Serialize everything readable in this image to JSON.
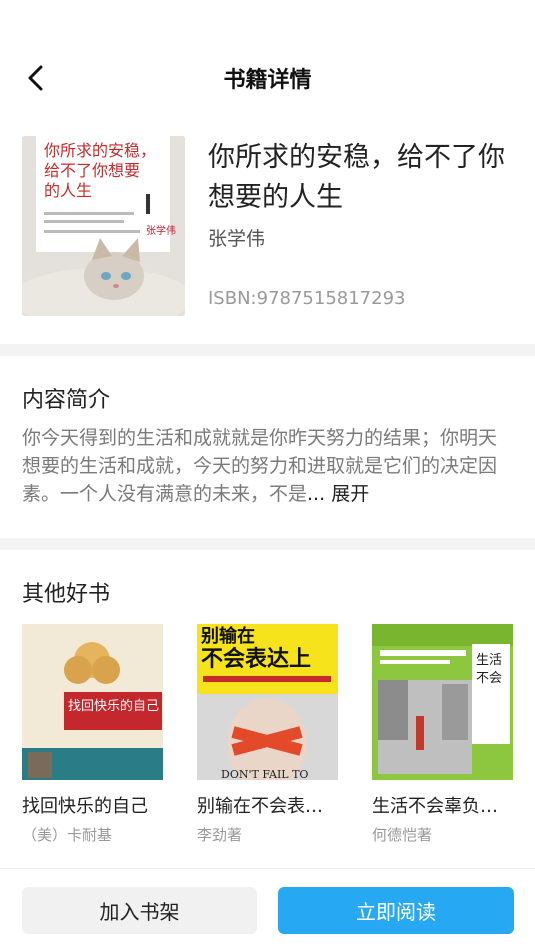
{
  "header": {
    "title": "书籍详情",
    "back_icon": "chevron-left-icon"
  },
  "book": {
    "name": "你所求的安稳，给不了你想要的人生",
    "author": "张学伟",
    "isbn": "ISBN:9787515817293",
    "cover_title": "你所求的安稳，给不了你想要的人生",
    "cover_author": "张学伟"
  },
  "intro": {
    "heading": "内容简介",
    "text": "你今天得到的生活和成就就是你昨天努力的结果；你明天想要的生活和成就，今天的努力和进取就是它们的决定因素。一个人没有满意的未来，不是",
    "ellipsis": "...",
    "expand_label": "展开"
  },
  "others": {
    "heading": "其他好书",
    "books": [
      {
        "name": "找回快乐的自己",
        "author": "（美）卡耐基",
        "cover_text": "找回快乐的自己"
      },
      {
        "name": "别输在不会表达上",
        "author": "李劲著",
        "cover_text": "别输在不会表达上",
        "cover_sub": "DON'T FAIL TO"
      },
      {
        "name": "生活不会辜负努力的你",
        "author": "何德恺著",
        "cover_text": "生活不会辜负努力的你"
      }
    ]
  },
  "actions": {
    "add_shelf": "加入书架",
    "read_now": "立即阅读"
  },
  "colors": {
    "primary": "#27a8f2",
    "secondary_btn": "#f1f1f1",
    "band": "#f3f3f3"
  }
}
